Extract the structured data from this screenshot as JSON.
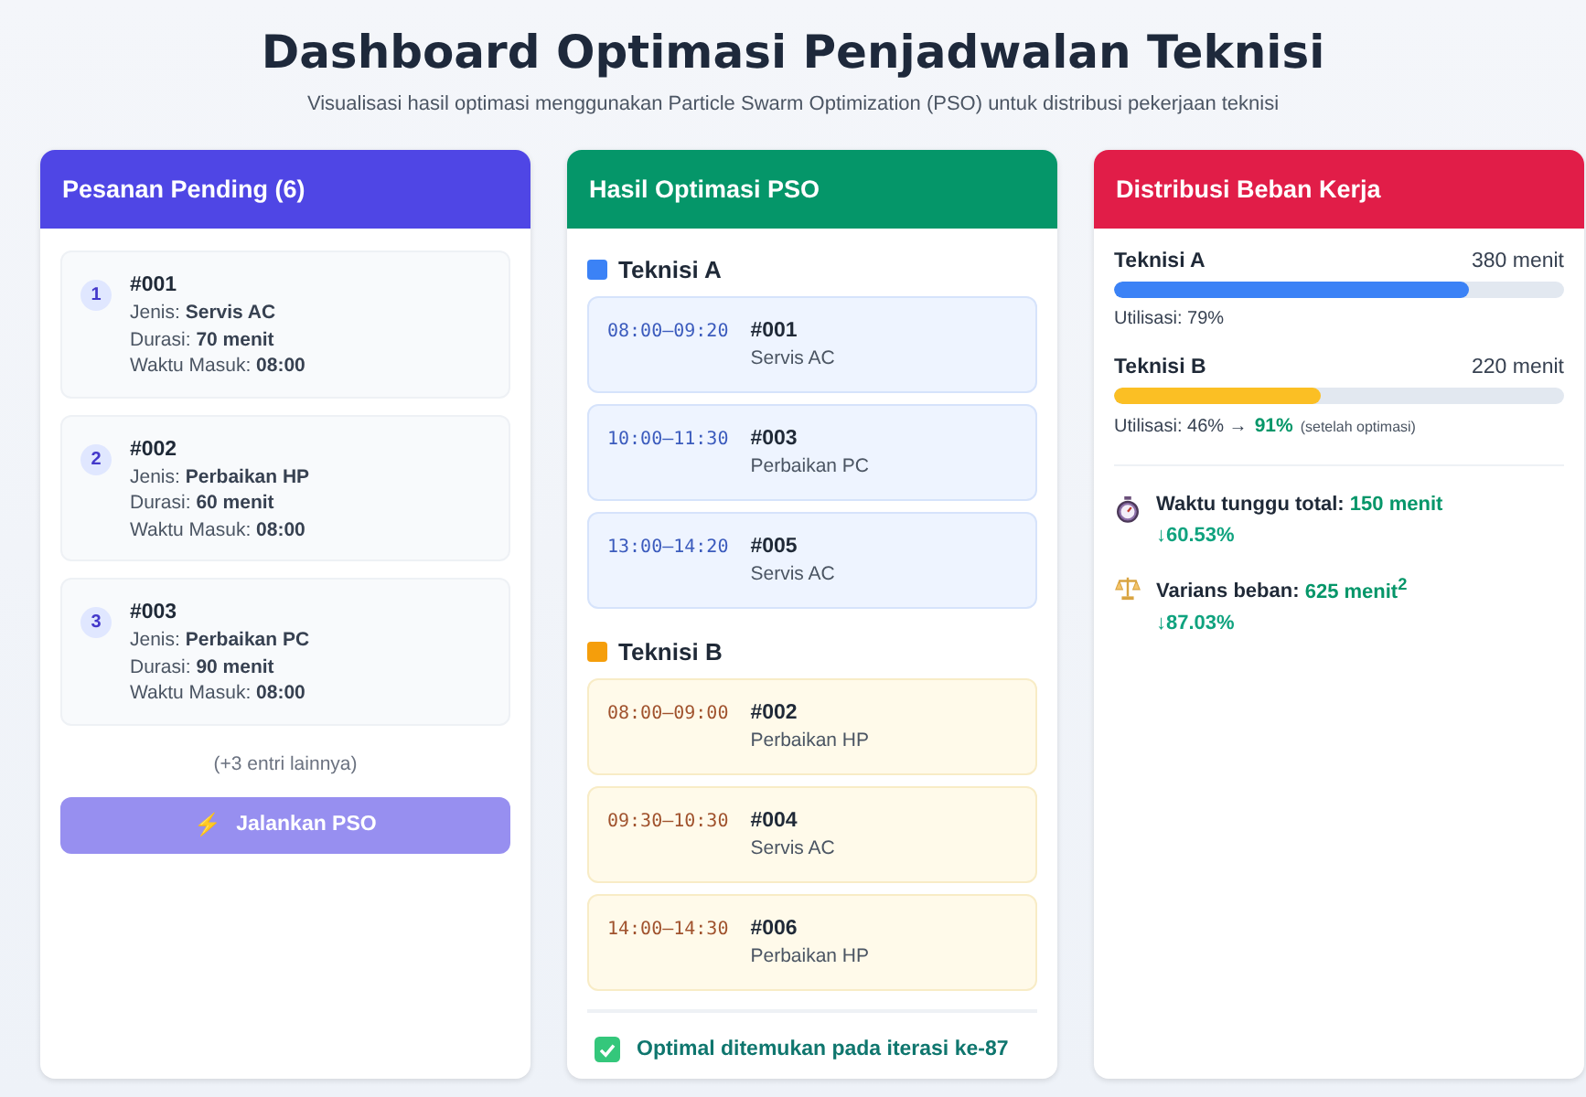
{
  "header": {
    "title": "Dashboard Optimasi Penjadwalan Teknisi",
    "subtitle": "Visualisasi hasil optimasi menggunakan Particle Swarm Optimization (PSO) untuk distribusi pekerjaan teknisi"
  },
  "pending": {
    "title": "Pesanan Pending (6)",
    "orders": [
      {
        "number": "1",
        "id": "#001",
        "lines": [
          "Jenis: **Servis AC**",
          "Durasi: **70 menit**",
          "Waktu Masuk: **08:00**"
        ]
      },
      {
        "number": "2",
        "id": "#002",
        "lines": [
          "Jenis: **Perbaikan HP**",
          "Durasi: **60 menit**",
          "Waktu Masuk: **08:00**"
        ]
      },
      {
        "number": "3",
        "id": "#003",
        "lines": [
          "Jenis: **Perbaikan PC**",
          "Durasi: **90 menit**",
          "Waktu Masuk: **08:00**"
        ]
      }
    ],
    "more": "(+3 entri lainnya)",
    "button": {
      "icon": "⚡",
      "label": "Jalankan PSO",
      "disabled": true
    }
  },
  "result": {
    "title": "Hasil Optimasi PSO",
    "technicians": [
      {
        "name": "Teknisi A",
        "color": "#3b82f6",
        "kind": "blue",
        "jobs": [
          {
            "time": "08:00–09:20",
            "id": "#001",
            "service": "Servis AC"
          },
          {
            "time": "10:00–11:30",
            "id": "#003",
            "service": "Perbaikan PC"
          },
          {
            "time": "13:00–14:20",
            "id": "#005",
            "service": "Servis AC"
          }
        ]
      },
      {
        "name": "Teknisi B",
        "color": "#f59e0b",
        "kind": "amber",
        "jobs": [
          {
            "time": "08:00–09:00",
            "id": "#002",
            "service": "Perbaikan HP"
          },
          {
            "time": "09:30–10:30",
            "id": "#004",
            "service": "Servis AC"
          },
          {
            "time": "14:00–14:30",
            "id": "#006",
            "service": "Perbaikan HP"
          }
        ]
      }
    ],
    "footer": {
      "checked": true,
      "text": "Optimal ditemukan pada iterasi ke-87"
    }
  },
  "workload": {
    "title": "Distribusi Beban Kerja",
    "technicians": [
      {
        "name": "Teknisi A",
        "minutes": "380 menit",
        "level": 0.79,
        "color": "#3b82f6",
        "utilisation": "Utilisasi: 79%"
      },
      {
        "name": "Teknisi B",
        "minutes": "220 menit",
        "level": 0.46,
        "color": "#fbbf24",
        "utilisation": "Utilisasi: 46% →",
        "after": "91%",
        "note": "(setelah optimasi)"
      }
    ],
    "metrics": [
      {
        "kind": "stopwatch",
        "label": "Waktu tunggu total:",
        "value": "150 menit",
        "change": "↓60.53%"
      },
      {
        "kind": "scale",
        "label": "Varians beban:",
        "value": "625 menit$^{2}$",
        "change": "↓87.03%"
      }
    ]
  }
}
